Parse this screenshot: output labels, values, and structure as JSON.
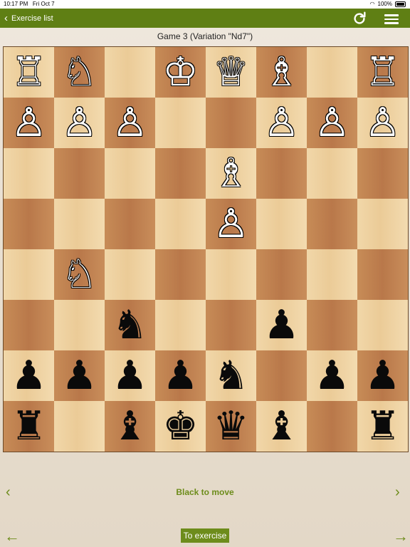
{
  "status": {
    "time": "10:17 PM",
    "date": "Fri Oct 7",
    "battery": "100%"
  },
  "nav": {
    "back_label": "Exercise list",
    "refresh_icon": "refresh-icon",
    "menu_icon": "hamburger-menu-icon",
    "color": "#5f7f14"
  },
  "game_title": "Game 3 (Variation \"Nd7\")",
  "board": {
    "rows": [
      [
        {
          "p": "R",
          "c": "white"
        },
        {
          "p": "N",
          "c": "white"
        },
        {
          "p": "",
          "c": ""
        },
        {
          "p": "K",
          "c": "white"
        },
        {
          "p": "Q",
          "c": "white"
        },
        {
          "p": "B",
          "c": "white"
        },
        {
          "p": "",
          "c": ""
        },
        {
          "p": "R",
          "c": "white"
        }
      ],
      [
        {
          "p": "P",
          "c": "white"
        },
        {
          "p": "P",
          "c": "white"
        },
        {
          "p": "P",
          "c": "white"
        },
        {
          "p": "",
          "c": ""
        },
        {
          "p": "",
          "c": ""
        },
        {
          "p": "P",
          "c": "white"
        },
        {
          "p": "P",
          "c": "white"
        },
        {
          "p": "P",
          "c": "white"
        }
      ],
      [
        {
          "p": "",
          "c": ""
        },
        {
          "p": "",
          "c": ""
        },
        {
          "p": "",
          "c": ""
        },
        {
          "p": "",
          "c": ""
        },
        {
          "p": "B",
          "c": "white"
        },
        {
          "p": "",
          "c": ""
        },
        {
          "p": "",
          "c": ""
        },
        {
          "p": "",
          "c": ""
        }
      ],
      [
        {
          "p": "",
          "c": ""
        },
        {
          "p": "",
          "c": ""
        },
        {
          "p": "",
          "c": ""
        },
        {
          "p": "",
          "c": ""
        },
        {
          "p": "P",
          "c": "white"
        },
        {
          "p": "",
          "c": ""
        },
        {
          "p": "",
          "c": ""
        },
        {
          "p": "",
          "c": ""
        }
      ],
      [
        {
          "p": "",
          "c": ""
        },
        {
          "p": "N",
          "c": "white"
        },
        {
          "p": "",
          "c": ""
        },
        {
          "p": "",
          "c": ""
        },
        {
          "p": "",
          "c": ""
        },
        {
          "p": "",
          "c": ""
        },
        {
          "p": "",
          "c": ""
        },
        {
          "p": "",
          "c": ""
        }
      ],
      [
        {
          "p": "",
          "c": ""
        },
        {
          "p": "",
          "c": ""
        },
        {
          "p": "N",
          "c": "black"
        },
        {
          "p": "",
          "c": ""
        },
        {
          "p": "",
          "c": ""
        },
        {
          "p": "P",
          "c": "black"
        },
        {
          "p": "",
          "c": ""
        },
        {
          "p": "",
          "c": ""
        }
      ],
      [
        {
          "p": "P",
          "c": "black"
        },
        {
          "p": "P",
          "c": "black"
        },
        {
          "p": "P",
          "c": "black"
        },
        {
          "p": "P",
          "c": "black"
        },
        {
          "p": "N",
          "c": "black"
        },
        {
          "p": "",
          "c": ""
        },
        {
          "p": "P",
          "c": "black"
        },
        {
          "p": "P",
          "c": "black"
        }
      ],
      [
        {
          "p": "R",
          "c": "black"
        },
        {
          "p": "",
          "c": ""
        },
        {
          "p": "B",
          "c": "black"
        },
        {
          "p": "K",
          "c": "black"
        },
        {
          "p": "Q",
          "c": "black"
        },
        {
          "p": "B",
          "c": "black"
        },
        {
          "p": "",
          "c": ""
        },
        {
          "p": "R",
          "c": "black"
        }
      ]
    ],
    "light_color": "#ebcb97",
    "dark_color": "#b9784a"
  },
  "turn_label": "Black to move",
  "exercise_button": "To exercise",
  "accent": "#6d8c1b"
}
